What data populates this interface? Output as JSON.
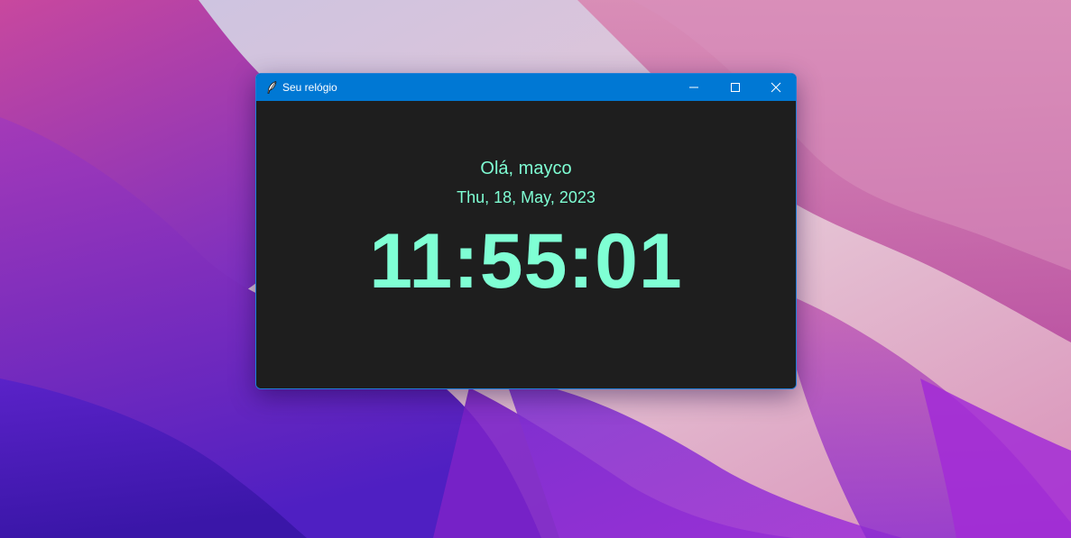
{
  "window": {
    "title": "Seu relógio",
    "icon": "feather-icon",
    "controls": {
      "minimize": "minimize-icon",
      "maximize": "maximize-icon",
      "close": "close-icon"
    }
  },
  "clock": {
    "greeting": "Olá, mayco",
    "date": "Thu, 18, May, 2023",
    "time": "11:55:01"
  },
  "colors": {
    "titlebar": "#0078d4",
    "background": "#1e1e1e",
    "text": "#7fffd4"
  }
}
